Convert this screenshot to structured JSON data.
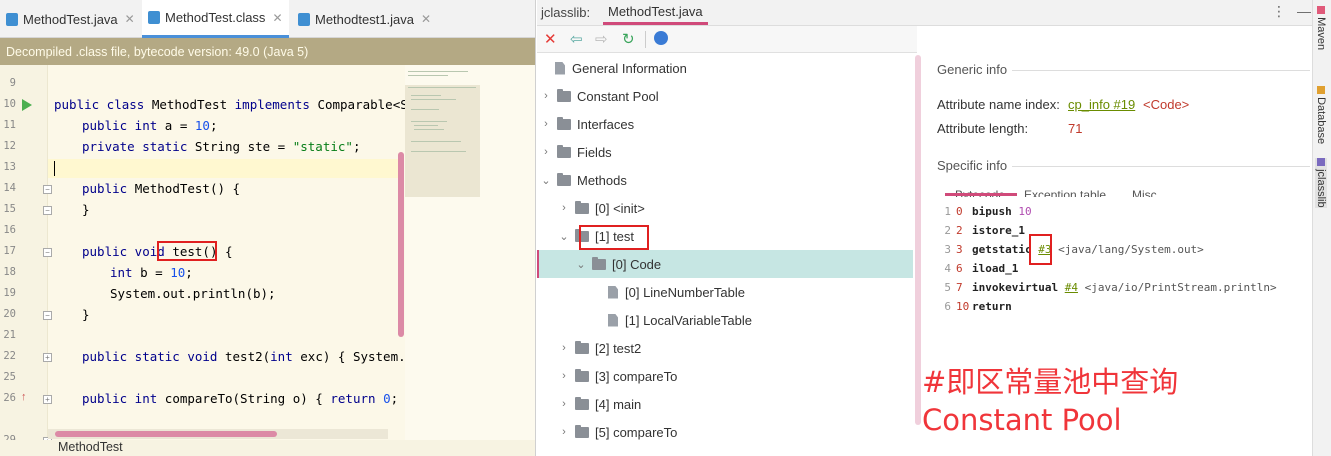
{
  "editor": {
    "tabs": [
      {
        "label": "MethodTest.java"
      },
      {
        "label": "MethodTest.class"
      },
      {
        "label": "Methodtest1.java"
      }
    ],
    "banner": "Decompiled .class file, bytecode version: 49.0 (Java 5)",
    "lines": [
      {
        "n": "9"
      },
      {
        "n": "10"
      },
      {
        "n": "11"
      },
      {
        "n": "12"
      },
      {
        "n": "13"
      },
      {
        "n": "14"
      },
      {
        "n": "15"
      },
      {
        "n": "16"
      },
      {
        "n": "17"
      },
      {
        "n": "18"
      },
      {
        "n": "19"
      },
      {
        "n": "20"
      },
      {
        "n": "21"
      },
      {
        "n": "22"
      },
      {
        "n": "25"
      },
      {
        "n": "26"
      },
      {
        "n": "29"
      }
    ],
    "code": {
      "l10a": "public class ",
      "l10b": "MethodTest ",
      "l10c": "implements ",
      "l10d": "Comparable<Strin",
      "l11a": "public int ",
      "l11b": "a = ",
      "l11c": "10",
      "l11d": ";",
      "l12a": "private static ",
      "l12b": "String ste = ",
      "l12c": "\"static\"",
      "l12d": ";",
      "l14a": "public ",
      "l14b": "MethodTest() {",
      "l15": "}",
      "l17a": "public void ",
      "l17b": "test() {",
      "l18a": "int ",
      "l18b": "b = ",
      "l18c": "10",
      "l18d": ";",
      "l19": "System.out.println(b);",
      "l20": "}",
      "l22a": "public static void ",
      "l22b": "test2(",
      "l22c": "int ",
      "l22d": "exc) { System.out",
      "l26a": "public int ",
      "l26b": "compareTo(String o) { ",
      "l26c": "return ",
      "l26d": "0",
      "l26e": "; }"
    },
    "breadcrumb": "MethodTest"
  },
  "jclasslib": {
    "tool_label": "jclasslib:",
    "file_tab": "MethodTest.java",
    "tree": {
      "general": "General Information",
      "constant_pool": "Constant Pool",
      "interfaces": "Interfaces",
      "fields": "Fields",
      "methods": "Methods",
      "m0": "[0] <init>",
      "m1": "[1] test",
      "code": "[0] Code",
      "lnt": "[0] LineNumberTable",
      "lvt": "[1] LocalVariableTable",
      "m2": "[2] test2",
      "m3": "[3] compareTo",
      "m4": "[4] main",
      "m5": "[5] compareTo"
    },
    "detail": {
      "generic_info": "Generic info",
      "attr_name_label": "Attribute name index:",
      "attr_name_link": "cp_info #19",
      "attr_name_val": "<Code>",
      "attr_len_label": "Attribute length:",
      "attr_len_val": "71",
      "specific_info": "Specific info",
      "subtab_bytecode": "Bytecode",
      "subtab_exception": "Exception table",
      "subtab_misc": "Misc",
      "bytecode": [
        {
          "n": "1",
          "off": "0",
          "ins": "bipush",
          "arg": "10",
          "ref": "",
          "cm": ""
        },
        {
          "n": "2",
          "off": "2",
          "ins": "istore_1",
          "arg": "",
          "ref": "",
          "cm": ""
        },
        {
          "n": "3",
          "off": "3",
          "ins": "getstatic",
          "arg": "",
          "ref": "#3",
          "cm": "<java/lang/System.out>"
        },
        {
          "n": "4",
          "off": "6",
          "ins": "iload_1",
          "arg": "",
          "ref": "",
          "cm": ""
        },
        {
          "n": "5",
          "off": "7",
          "ins": "invokevirtual",
          "arg": "",
          "ref": "#4",
          "cm": "<java/io/PrintStream.println>"
        },
        {
          "n": "6",
          "off": "10",
          "ins": "return",
          "arg": "",
          "ref": "",
          "cm": ""
        }
      ]
    }
  },
  "annotation": {
    "line1": "#即区常量池中查询",
    "line2": "Constant Pool"
  },
  "side_tabs": {
    "maven": "Maven",
    "database": "Database",
    "jclasslib": "jclasslib"
  }
}
